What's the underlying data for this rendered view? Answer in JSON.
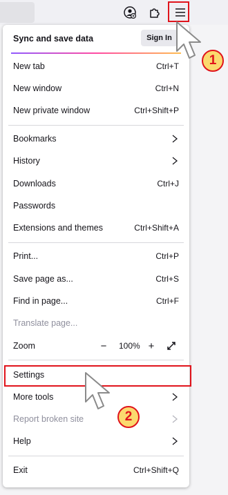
{
  "toolbar": {
    "account_icon": "account-icon",
    "extensions_icon": "extensions-icon",
    "menu_icon": "hamburger-menu-icon"
  },
  "menu": {
    "sync": {
      "label": "Sync and save data",
      "button": "Sign In"
    },
    "items": [
      {
        "label": "New tab",
        "shortcut": "Ctrl+T"
      },
      {
        "label": "New window",
        "shortcut": "Ctrl+N"
      },
      {
        "label": "New private window",
        "shortcut": "Ctrl+Shift+P"
      },
      {
        "label": "Bookmarks",
        "submenu": true
      },
      {
        "label": "History",
        "submenu": true
      },
      {
        "label": "Downloads",
        "shortcut": "Ctrl+J"
      },
      {
        "label": "Passwords"
      },
      {
        "label": "Extensions and themes",
        "shortcut": "Ctrl+Shift+A"
      },
      {
        "label": "Print...",
        "shortcut": "Ctrl+P"
      },
      {
        "label": "Save page as...",
        "shortcut": "Ctrl+S"
      },
      {
        "label": "Find in page...",
        "shortcut": "Ctrl+F"
      },
      {
        "label": "Translate page...",
        "disabled": true
      },
      {
        "label": "Settings"
      },
      {
        "label": "More tools",
        "submenu": true
      },
      {
        "label": "Report broken site",
        "submenu": true,
        "disabled": true
      },
      {
        "label": "Help",
        "submenu": true
      },
      {
        "label": "Exit",
        "shortcut": "Ctrl+Shift+Q"
      }
    ],
    "zoom": {
      "label": "Zoom",
      "minus": "−",
      "value": "100%",
      "plus": "+"
    }
  },
  "annotations": {
    "step1": "1",
    "step2": "2"
  },
  "colors": {
    "highlight": "#e0131b",
    "badge_fill": "#fbd96e",
    "disabled_text": "#8f8f9d"
  }
}
